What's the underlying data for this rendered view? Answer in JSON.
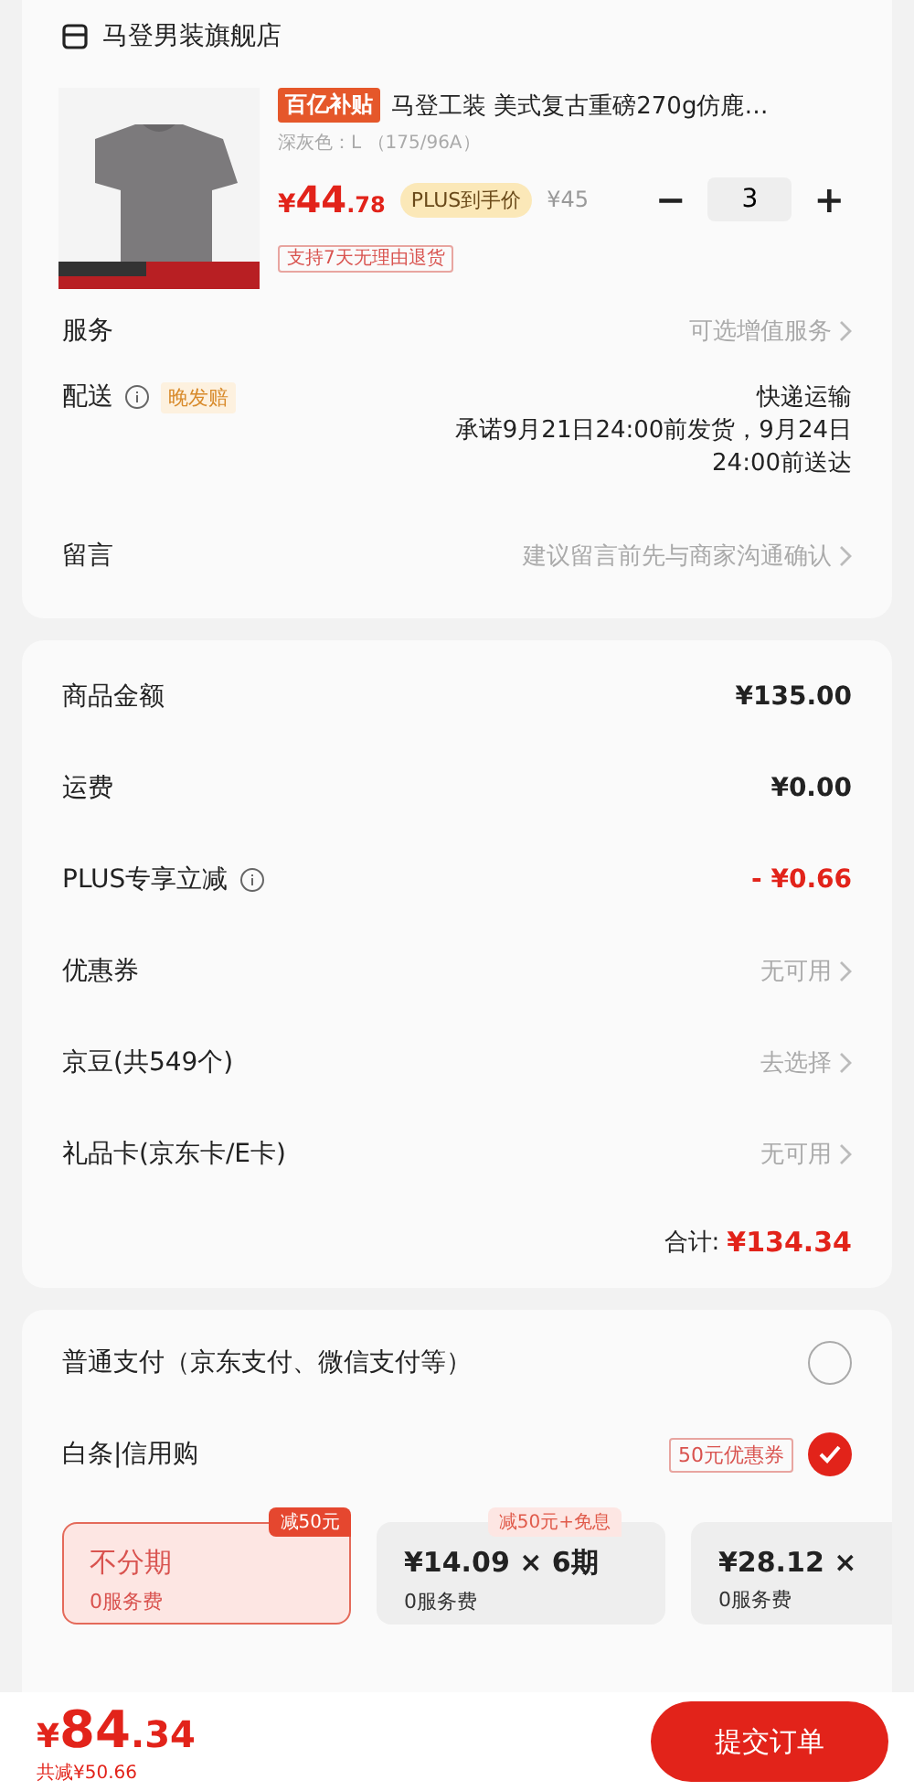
{
  "store": {
    "name": "马登男装旗舰店"
  },
  "product": {
    "badge": "百亿补贴",
    "title": "马登工装 美式复古重磅270g仿鹿…",
    "variant": "深灰色：L （175/96A）",
    "price_symbol": "¥",
    "price_int": "44",
    "price_dec": ".78",
    "plus_label": "PLUS到手价",
    "original_price": "¥45",
    "minus": "−",
    "quantity": "3",
    "plus": "+",
    "promise": "支持7天无理由退货"
  },
  "order_rows": [
    {
      "kind": "link",
      "label": "服务",
      "value": "可选增值服务"
    },
    {
      "kind": "delivery",
      "label": "配送",
      "tag": "晚发赔",
      "method": "快递运输",
      "promise": "承诺9月21日24:00前发货，9月24日24:00前送达"
    },
    {
      "kind": "link",
      "label": "留言",
      "value": "建议留言前先与商家沟通确认"
    }
  ],
  "summary": [
    {
      "kind": "amount",
      "label": "商品金额",
      "value": "¥135.00"
    },
    {
      "kind": "amount",
      "label": "运费",
      "value": "¥0.00"
    },
    {
      "kind": "discount",
      "label": "PLUS专享立减",
      "value": "- ¥0.66"
    },
    {
      "kind": "link",
      "label": "优惠券",
      "value": "无可用"
    },
    {
      "kind": "link",
      "label": "京豆(共549个)",
      "value": "去选择"
    },
    {
      "kind": "link",
      "label": "礼品卡(京东卡/E卡)",
      "value": "无可用"
    }
  ],
  "total": {
    "label": "合计:",
    "value": "¥134.34"
  },
  "payment": [
    {
      "label": "普通支付（京东支付、微信支付等）",
      "selected": false
    },
    {
      "label": "白条|信用购",
      "tag": "50元优惠券",
      "selected": true
    }
  ],
  "installments": [
    {
      "top_tag": "减50元",
      "main": "不分期",
      "sub": "0服务费",
      "selected": true
    },
    {
      "top_tag": "减50元+免息",
      "main": "¥14.09 × 6期",
      "sub": "0服务费",
      "selected": false
    },
    {
      "main": "¥28.12 ×",
      "sub": "0服务费",
      "selected": false
    }
  ],
  "footer": {
    "price_symbol": "¥",
    "price_int": "84",
    "price_dec": ".34",
    "saved": "共减¥50.66",
    "submit": "提交订单"
  }
}
